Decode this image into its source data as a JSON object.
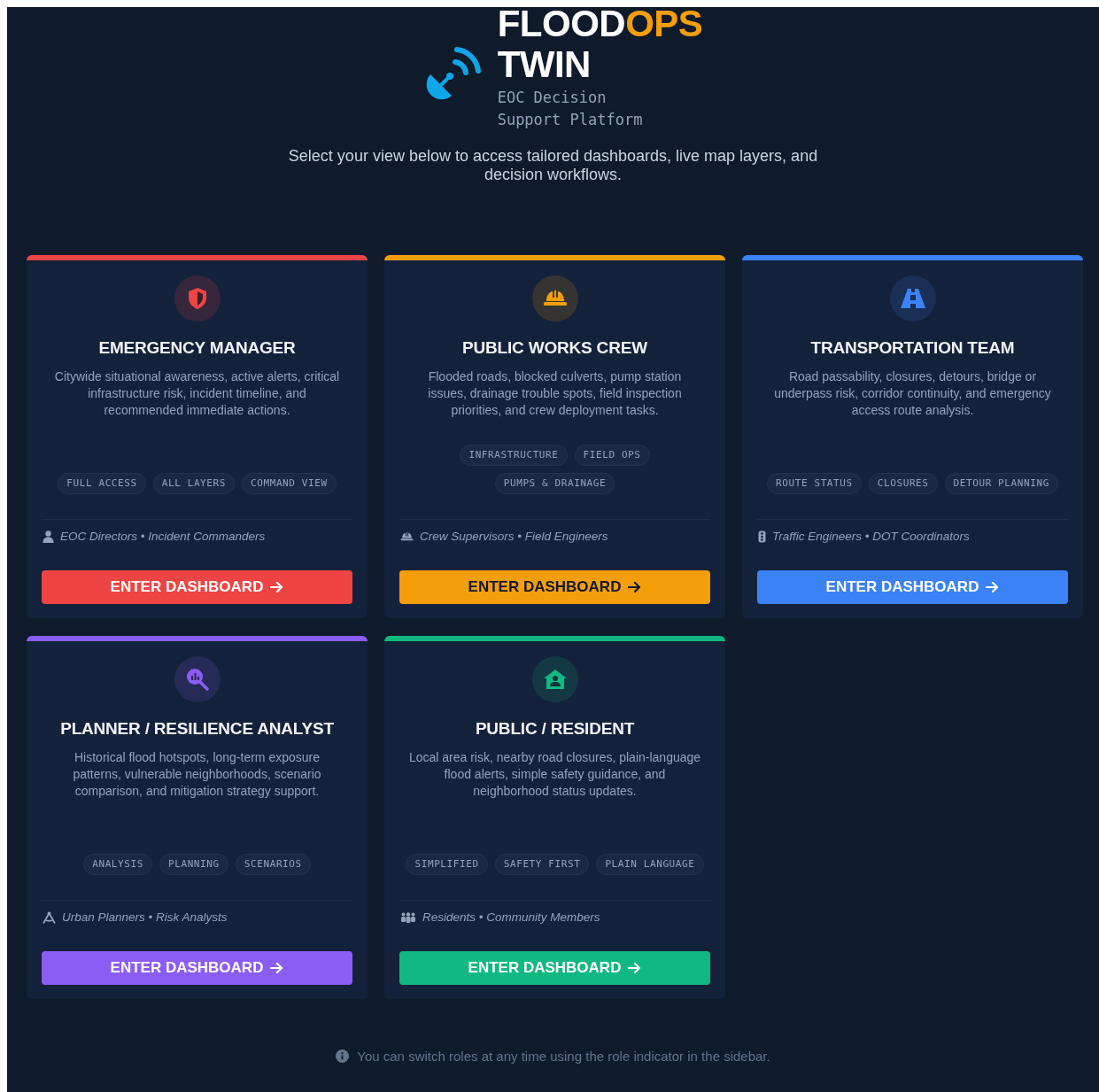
{
  "brand": {
    "title": {
      "main": "FLOOD",
      "accent": "OPS",
      "line2": "TWIN"
    },
    "subtitle": "EOC Decision Support Platform"
  },
  "tagline": "Select your view below to access tailored dashboards, live map layers, and decision workflows.",
  "cards": [
    {
      "title": "EMERGENCY MANAGER",
      "color": "#ef4444",
      "description": "Citywide situational awareness, active alerts, critical infrastructure risk, incident timeline, and recommended immediate actions.",
      "tags": [
        "FULL ACCESS",
        "ALL LAYERS",
        "COMMAND VIEW"
      ],
      "audience": "EOC Directors • Incident Commanders",
      "button": "ENTER DASHBOARD"
    },
    {
      "title": "PUBLIC WORKS CREW",
      "color": "#f59e0b",
      "description": "Flooded roads, blocked culverts, pump station issues, drainage trouble spots, field inspection priorities, and crew deployment tasks.",
      "tags": [
        "INFRASTRUCTURE",
        "FIELD OPS",
        "PUMPS & DRAINAGE"
      ],
      "audience": "Crew Supervisors • Field Engineers",
      "button": "ENTER DASHBOARD"
    },
    {
      "title": "TRANSPORTATION TEAM",
      "color": "#3b82f6",
      "description": "Road passability, closures, detours, bridge or underpass risk, corridor continuity, and emergency access route analysis.",
      "tags": [
        "ROUTE STATUS",
        "CLOSURES",
        "DETOUR PLANNING"
      ],
      "audience": "Traffic Engineers • DOT Coordinators",
      "button": "ENTER DASHBOARD"
    },
    {
      "title": "PLANNER / RESILIENCE ANALYST",
      "color": "#8b5cf6",
      "description": "Historical flood hotspots, long-term exposure patterns, vulnerable neighborhoods, scenario comparison, and mitigation strategy support.",
      "tags": [
        "ANALYSIS",
        "PLANNING",
        "SCENARIOS"
      ],
      "audience": "Urban Planners • Risk Analysts",
      "button": "ENTER DASHBOARD"
    },
    {
      "title": "PUBLIC / RESIDENT",
      "color": "#10b981",
      "description": "Local area risk, nearby road closures, plain-language flood alerts, simple safety guidance, and neighborhood status updates.",
      "tags": [
        "SIMPLIFIED",
        "SAFETY FIRST",
        "PLAIN LANGUAGE"
      ],
      "audience": "Residents • Community Members",
      "button": "ENTER DASHBOARD"
    }
  ],
  "footer_note": "You can switch roles at any time using the role indicator in the sidebar."
}
